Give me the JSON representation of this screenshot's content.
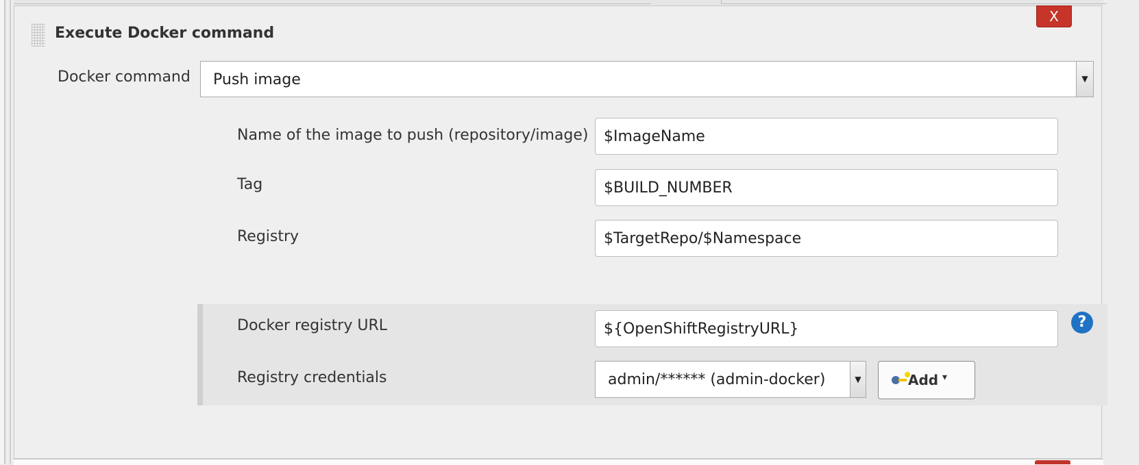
{
  "step": {
    "title": "Execute Docker command",
    "delete_label": "X"
  },
  "docker_command": {
    "label": "Docker command",
    "selected": "Push image"
  },
  "fields": {
    "image_name": {
      "label": "Name of the image to push (repository/image)",
      "value": "$ImageName"
    },
    "tag": {
      "label": "Tag",
      "value": "$BUILD_NUMBER"
    },
    "registry": {
      "label": "Registry",
      "value": "$TargetRepo/$Namespace"
    }
  },
  "advanced": {
    "registry_url": {
      "label": "Docker registry URL",
      "value": "${OpenShiftRegistryURL}"
    },
    "credentials": {
      "label": "Registry credentials",
      "selected": "admin/****** (admin-docker)"
    },
    "add_button_label": "Add",
    "help_glyph": "?"
  },
  "icons": {
    "help": "question-circle-icon",
    "add": "key-icon",
    "add_caret": "caret-down-icon",
    "select_arrow": "dropdown-arrow-icon",
    "drag": "drag-handle-icon"
  },
  "colors": {
    "delete_button": "#c6342a",
    "help_icon": "#1f72c4",
    "panel_bg": "#efefef",
    "advanced_bg": "#e5e5e5"
  }
}
